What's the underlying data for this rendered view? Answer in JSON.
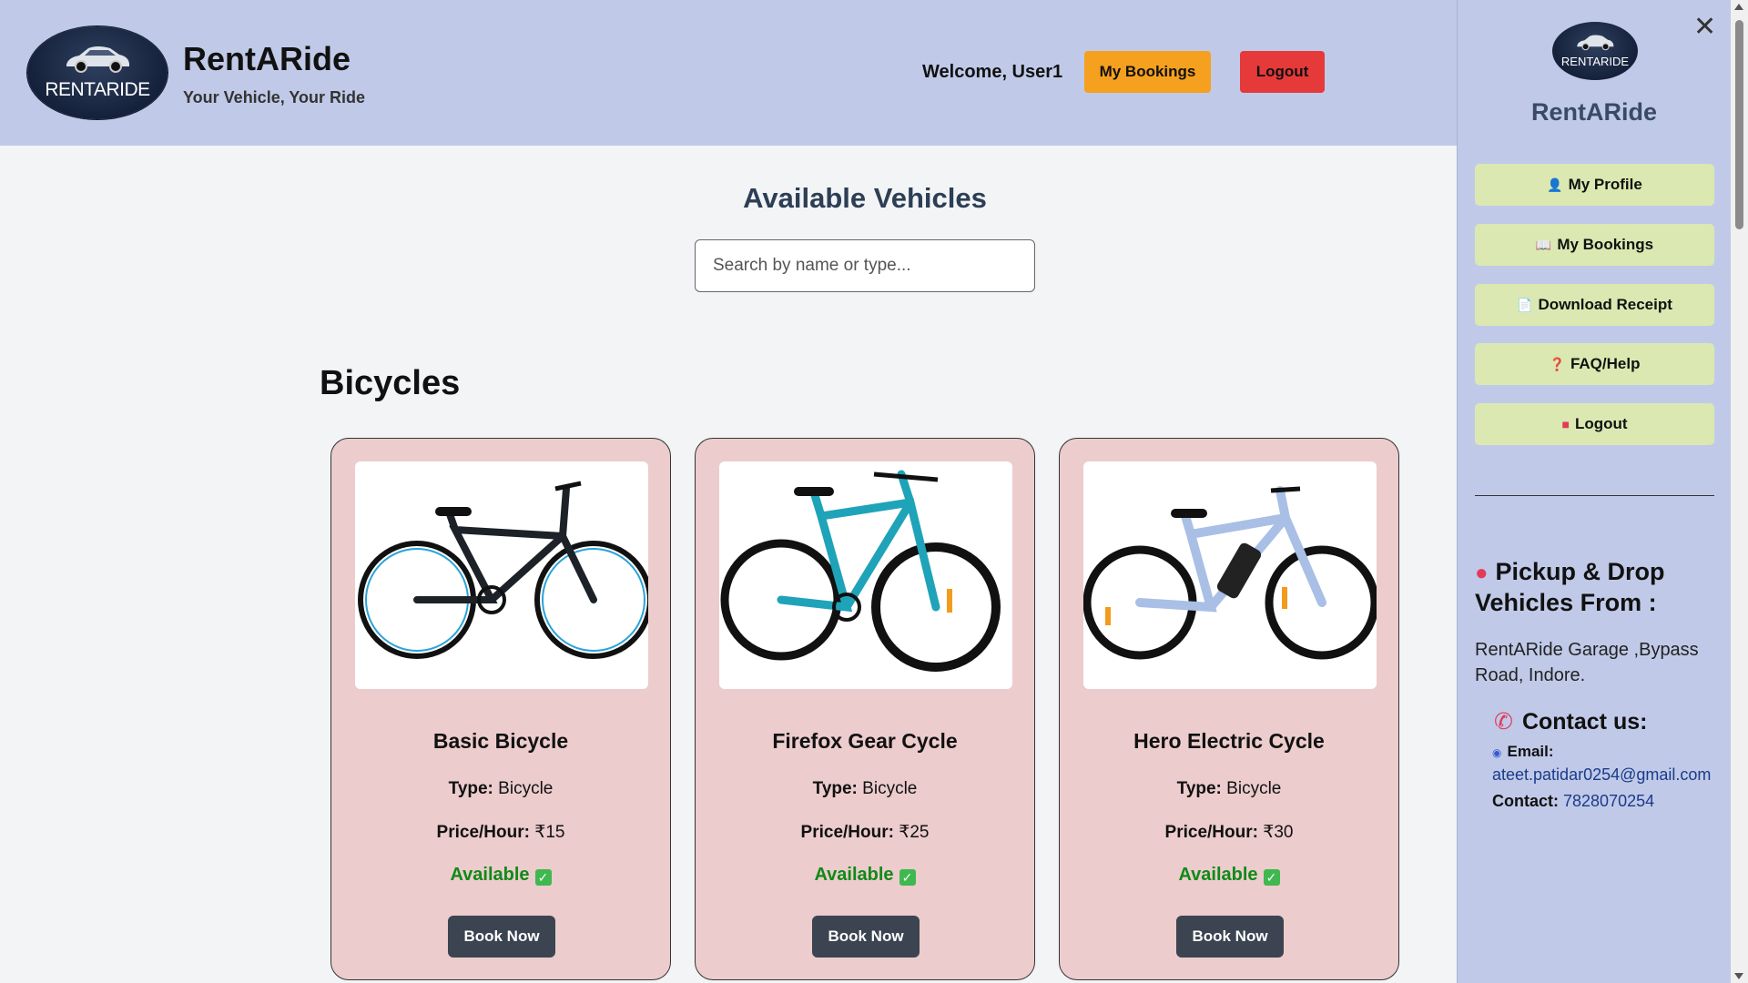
{
  "header": {
    "logo_text": "RENTARIDE",
    "title": "RentARide",
    "subtitle": "Your Vehicle, Your Ride",
    "welcome": "Welcome, User1",
    "my_bookings_label": "My Bookings",
    "logout_label": "Logout"
  },
  "main": {
    "title": "Available Vehicles",
    "search_placeholder": "Search by name or type...",
    "section_title": "Bicycles",
    "type_label": "Type:",
    "price_label": "Price/Hour:",
    "book_label": "Book Now",
    "vehicles": [
      {
        "name": "Basic Bicycle",
        "type": "Bicycle",
        "price": "₹15",
        "status": "Available",
        "image_icon": "black-mtb-bicycle",
        "frame_color": "#1c2228"
      },
      {
        "name": "Firefox Gear Cycle",
        "type": "Bicycle",
        "price": "₹25",
        "status": "Available",
        "image_icon": "teal-gear-bicycle",
        "frame_color": "#1fa3b8"
      },
      {
        "name": "Hero Electric Cycle",
        "type": "Bicycle",
        "price": "₹30",
        "status": "Available",
        "image_icon": "electric-bicycle",
        "frame_color": "#a9bfe6"
      }
    ]
  },
  "sidebar": {
    "close_icon": "close-icon",
    "logo_text": "RENTARIDE",
    "brand": "RentARide",
    "menu": [
      {
        "label": "My Profile",
        "icon": "👤"
      },
      {
        "label": "My Bookings",
        "icon": "📖"
      },
      {
        "label": "Download Receipt",
        "icon": "📄"
      },
      {
        "label": "FAQ/Help",
        "icon": "❓"
      },
      {
        "label": "Logout",
        "icon": "■"
      }
    ],
    "pickup_title": "Pickup & Drop Vehicles From :",
    "pickup_address": "RentARide Garage ,Bypass Road, Indore.",
    "contact_title": "Contact us:",
    "email_label": "Email:",
    "email": "ateet.patidar0254@gmail.com",
    "contact_label": "Contact:",
    "phone": "7828070254"
  },
  "colors": {
    "header_bg": "#c0cae8",
    "card_bg": "#eccccd",
    "available": "#0f8a17",
    "bookings_btn": "#f5a01f",
    "logout_btn": "#e6393a",
    "menu_btn": "#dbe8b1"
  }
}
